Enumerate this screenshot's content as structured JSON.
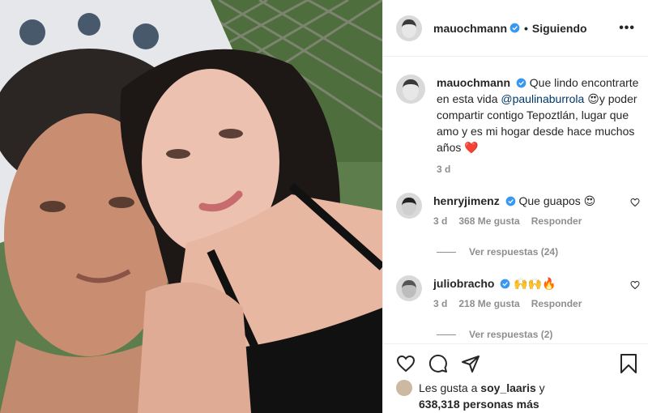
{
  "header": {
    "username": "mauochmann",
    "separator": "•",
    "follow_label": "Siguiendo",
    "more_label": "•••"
  },
  "caption": {
    "username": "mauochmann",
    "text_before": "Que lindo encontrarte en esta vida",
    "mention": "@paulinaburrola",
    "emoji": "😍",
    "text_after": "y poder compartir contigo Tepoztlán, lugar que amo y es mi hogar desde hace muchos años",
    "heart": "❤️",
    "time": "3 d"
  },
  "comments": [
    {
      "username": "henryjimenz",
      "text": "Que guapos 😍",
      "time": "3 d",
      "likes": "368 Me gusta",
      "reply": "Responder",
      "view_replies": "Ver respuestas (24)"
    },
    {
      "username": "juliobracho",
      "text": "🙌🙌🔥",
      "time": "3 d",
      "likes": "218 Me gusta",
      "reply": "Responder",
      "view_replies": "Ver respuestas (2)"
    }
  ],
  "likes": {
    "prefix": "Les gusta a",
    "user": "soy_laaris",
    "conj": "y",
    "others": "638,318 personas más"
  },
  "colors": {
    "verified": "#3897f0",
    "mention": "#00376b",
    "muted": "#8e8e8e"
  },
  "icons": [
    "verified-badge-icon",
    "heart-icon",
    "comment-icon",
    "share-icon",
    "bookmark-icon",
    "more-icon"
  ]
}
